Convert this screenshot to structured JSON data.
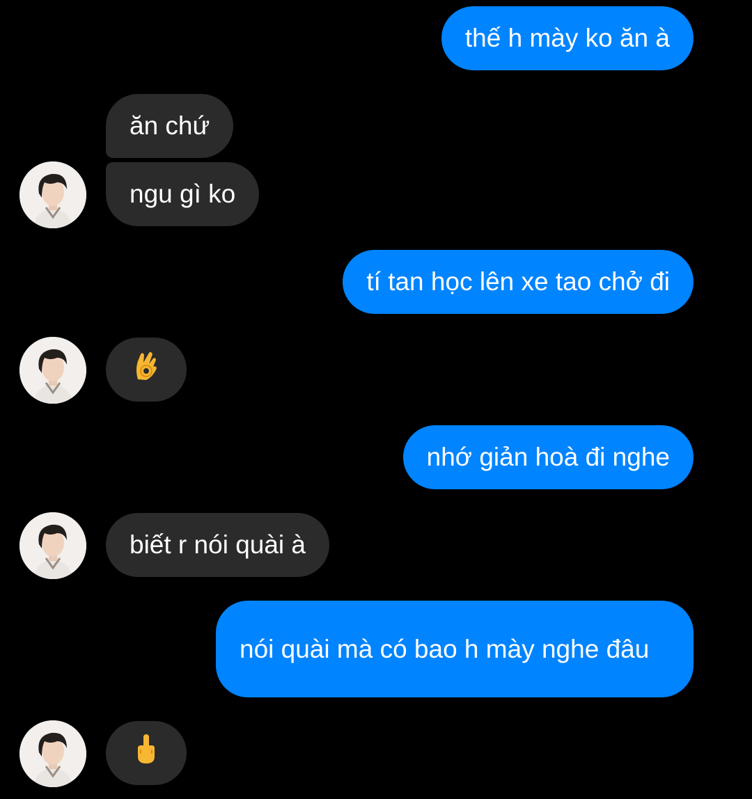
{
  "conversation": {
    "messages": [
      {
        "sender": "me",
        "text": "thế h mày ko ăn à"
      },
      {
        "sender": "contact",
        "text": "ăn chứ"
      },
      {
        "sender": "contact",
        "text": "ngu gì ko"
      },
      {
        "sender": "me",
        "text": "tí tan học lên xe tao chở đi"
      },
      {
        "sender": "contact",
        "emoji": "ok-hand-emoji"
      },
      {
        "sender": "me",
        "text": "nhớ giản hoà đi nghe"
      },
      {
        "sender": "contact",
        "text": "biết r nói quài à"
      },
      {
        "sender": "me",
        "text": "nói quài mà có bao h mày nghe đâu"
      },
      {
        "sender": "contact",
        "emoji": "middle-finger-emoji"
      }
    ]
  },
  "colors": {
    "background": "#000000",
    "sent_bubble": "#0084ff",
    "received_bubble": "#2b2b2b",
    "text": "#ffffff",
    "emoji": "#f7b733"
  },
  "icons": [
    "contact-avatar",
    "ok-hand-emoji",
    "middle-finger-emoji"
  ]
}
